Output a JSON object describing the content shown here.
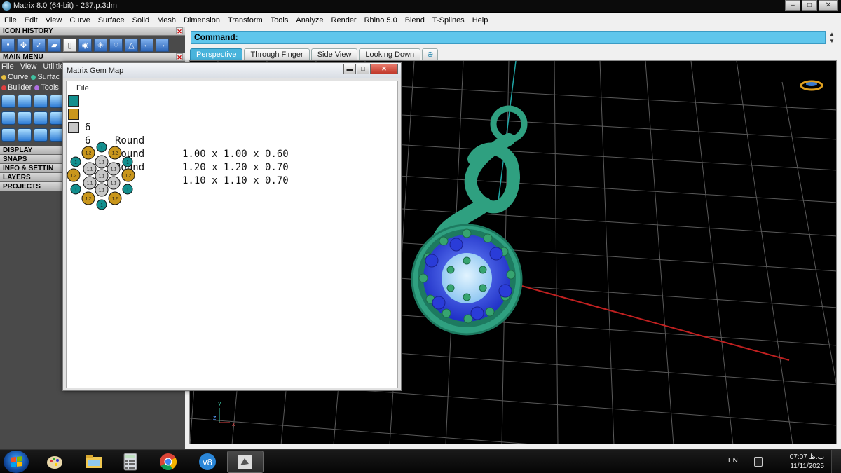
{
  "window": {
    "title": "Matrix 8.0 (64-bit) - 237.p.3dm",
    "minimize": "–",
    "maximize": "□",
    "close": "✕"
  },
  "menu": [
    "File",
    "Edit",
    "View",
    "Curve",
    "Surface",
    "Solid",
    "Mesh",
    "Dimension",
    "Transform",
    "Tools",
    "Analyze",
    "Render",
    "Rhino 5.0",
    "Blend",
    "T-Splines",
    "Help"
  ],
  "icon_history": {
    "label": "ICON HISTORY",
    "close": "✕",
    "icons": [
      "point-icon",
      "move-icon",
      "check-icon",
      "open-icon",
      "new-icon",
      "globe-icon",
      "snap-icon",
      "ring-icon",
      "layer-icon",
      "back-icon",
      "forward-icon"
    ]
  },
  "main_menu": {
    "label": "MAIN MENU",
    "close": "✕",
    "menus": [
      "File",
      "View",
      "Utilitie"
    ],
    "row1": [
      "Curve",
      "Surfac"
    ],
    "row2": [
      "Builder",
      "Tools"
    ],
    "row1_colors": [
      "#e8c040",
      "#40c0a0"
    ],
    "row2_colors": [
      "#e04040",
      "#b070e0"
    ]
  },
  "sections": [
    "DISPLAY",
    "SNAPS",
    "INFO & SETTIN",
    "LAYERS",
    "PROJECTS"
  ],
  "command": {
    "label": "Command:"
  },
  "tabs": [
    {
      "label": "Perspective",
      "active": true
    },
    {
      "label": "Through Finger",
      "active": false
    },
    {
      "label": "Side View",
      "active": false
    },
    {
      "label": "Looking Down",
      "active": false
    }
  ],
  "tab_add": "⊕",
  "gem_map": {
    "title": "Matrix Gem Map",
    "menu_file": "File",
    "minimize": "▬",
    "maximize": "□",
    "close": "✕",
    "rows": [
      {
        "color": "#138f8e",
        "count": "6",
        "shape": "Round",
        "size": "1.00 x 1.00 x 0.60"
      },
      {
        "color": "#c9961c",
        "count": "6",
        "shape": "Round",
        "size": "1.20 x 1.20 x 0.70"
      },
      {
        "color": "#c7c7c7",
        "count": "7",
        "shape": "Round",
        "size": "1.10 x 1.10 x 0.70"
      }
    ],
    "cluster_labels": {
      "teal": "1",
      "gold": "1.2",
      "gray": "1.1"
    }
  },
  "axis": {
    "y": "y",
    "z": "z",
    "x": "x"
  },
  "taskbar": {
    "language": "EN",
    "time": "07:07 ب.ظ",
    "date": "11/11/2025",
    "apps": [
      "paint-app-icon",
      "explorer-app-icon",
      "calculator-app-icon",
      "chrome-app-icon",
      "v8-app-icon",
      "matrix-app-icon"
    ]
  }
}
